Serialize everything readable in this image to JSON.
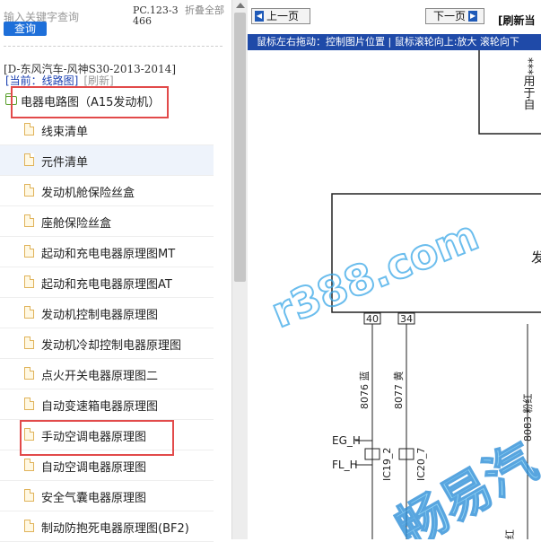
{
  "search": {
    "placeholder": "输入关键字查询",
    "button": "查询"
  },
  "header": {
    "pc_code": "PC.123-3466",
    "collapse_all": "折叠全部"
  },
  "tree": {
    "model": "[D-东风汽车-风神S30-2013-2014]",
    "current_label": "[当前：线路图]",
    "refresh": "[刷新]",
    "root_label": "电器电路图（A15发动机）",
    "items": [
      {
        "label": "线束清单"
      },
      {
        "label": "元件清单"
      },
      {
        "label": "发动机舱保险丝盒"
      },
      {
        "label": "座舱保险丝盒"
      },
      {
        "label": "起动和充电电器原理图MT"
      },
      {
        "label": "起动和充电电器原理图AT"
      },
      {
        "label": "发动机控制电器原理图"
      },
      {
        "label": "发动机冷却控制电器原理图"
      },
      {
        "label": "点火开关电器原理图二"
      },
      {
        "label": "自动变速箱电器原理图"
      },
      {
        "label": "手动空调电器原理图"
      },
      {
        "label": "自动空调电器原理图"
      },
      {
        "label": "安全气囊电器原理图"
      },
      {
        "label": "制动防抱死电器原理图(BF2)"
      }
    ]
  },
  "viewer": {
    "prev_page": "上一页",
    "next_page": "下一页",
    "refresh": "[刷新当",
    "hint": "鼠标左右拖动：控制图片位置 | 鼠标滚轮向上:放大   滚轮向下",
    "diagram": {
      "side_text": "***用于自",
      "box_text": "发",
      "pin_1": "40",
      "pin_2": "34",
      "wire_1": "8076 蓝",
      "wire_2": "8077 黄",
      "wire_3": "8083 粉红",
      "signal_1": "EG_H",
      "signal_2": "FL_H",
      "connector_1": "IC19_2",
      "connector_2": "IC20_7",
      "bottom_text": "红"
    },
    "watermark": {
      "url": "r388.com",
      "brand": "畅易汽"
    }
  },
  "colors": {
    "accent": "#1e6fd9",
    "hint_bar": "#1f4aa8",
    "highlight": "#e24a4a",
    "watermark": "#3aa8e8"
  }
}
